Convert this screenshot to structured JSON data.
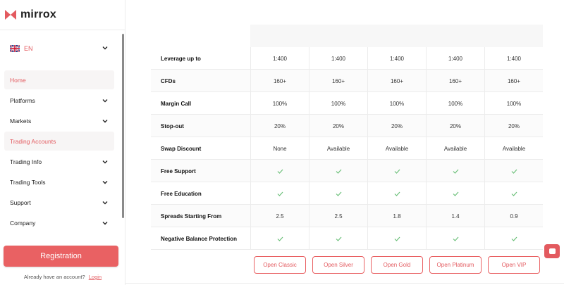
{
  "brand": {
    "name": "mirrox",
    "accent": "#e35a5f"
  },
  "sidebar": {
    "language": {
      "code": "EN",
      "flag_icon": "uk-flag-icon"
    },
    "items": [
      {
        "label": "Home",
        "active": true,
        "has_chevron": false
      },
      {
        "label": "Platforms",
        "active": false,
        "has_chevron": true
      },
      {
        "label": "Markets",
        "active": false,
        "has_chevron": true
      },
      {
        "label": "Trading Accounts",
        "active": true,
        "has_chevron": false
      },
      {
        "label": "Trading Info",
        "active": false,
        "has_chevron": true
      },
      {
        "label": "Trading Tools",
        "active": false,
        "has_chevron": true
      },
      {
        "label": "Support",
        "active": false,
        "has_chevron": true
      },
      {
        "label": "Company",
        "active": false,
        "has_chevron": true
      }
    ],
    "registration_label": "Registration",
    "login_prompt": "Already have an account?",
    "login_label": "Login"
  },
  "table": {
    "rows": [
      {
        "label": "Leverage up to",
        "values": [
          "1:400",
          "1:400",
          "1:400",
          "1:400",
          "1:400"
        ]
      },
      {
        "label": "CFDs",
        "values": [
          "160+",
          "160+",
          "160+",
          "160+",
          "160+"
        ]
      },
      {
        "label": "Margin Call",
        "values": [
          "100%",
          "100%",
          "100%",
          "100%",
          "100%"
        ]
      },
      {
        "label": "Stop-out",
        "values": [
          "20%",
          "20%",
          "20%",
          "20%",
          "20%"
        ]
      },
      {
        "label": "Swap Discount",
        "values": [
          "None",
          "Available",
          "Available",
          "Available",
          "Available"
        ]
      },
      {
        "label": "Free Support",
        "values": [
          "✓",
          "✓",
          "✓",
          "✓",
          "✓"
        ]
      },
      {
        "label": "Free Education",
        "values": [
          "✓",
          "✓",
          "✓",
          "✓",
          "✓"
        ]
      },
      {
        "label": "Spreads Starting From",
        "values": [
          "2.5",
          "2.5",
          "1.8",
          "1.4",
          "0.9"
        ]
      },
      {
        "label": "Negative Balance Protection",
        "values": [
          "✓",
          "✓",
          "✓",
          "✓",
          "✓"
        ]
      }
    ],
    "open_buttons": [
      "Open Classic",
      "Open Silver",
      "Open Gold",
      "Open Platinum",
      "Open VIP"
    ]
  },
  "chat": {
    "icon": "chat-icon"
  }
}
